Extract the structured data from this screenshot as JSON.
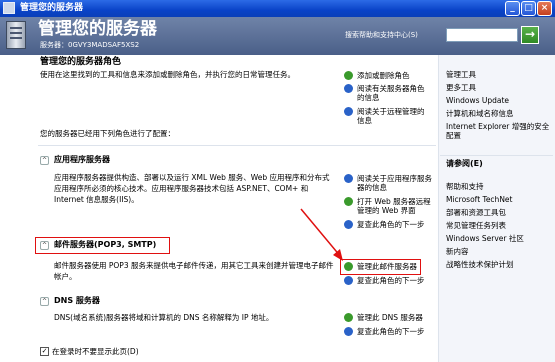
{
  "window": {
    "title": "管理您的服务器",
    "controls": {
      "minimize": "_",
      "maximize": "□",
      "close": "×"
    }
  },
  "header": {
    "title": "管理您的服务器",
    "server_label": "服务器：0GVY3MADSAF5XS2",
    "search_label": "搜索帮助和支持中心(S)",
    "search_value": "",
    "go_button": "→"
  },
  "main": {
    "heading": "管理您的服务器角色",
    "intro": "使用在这里找到的工具和信息来添加或删除角色，并执行您的日常管理任务。",
    "configured_text": "您的服务器已经用下列角色进行了配置：",
    "top_links": [
      {
        "label": "添加或删除角色",
        "icon": "go-arrow-icon"
      },
      {
        "label": "阅读有关服务器角色的信息",
        "icon": "info-icon"
      },
      {
        "label": "阅读关于远程管理的信息",
        "icon": "info-icon"
      }
    ],
    "roles": [
      {
        "title": "应用程序服务器",
        "desc": "应用程序服务器提供构造、部署以及运行 XML Web 服务、Web 应用程序和分布式应用程序所必须的核心技术。应用程序服务器技术包括 ASP.NET、COM+ 和 Internet 信息服务(IIS)。",
        "links": [
          {
            "label": "阅读关于应用程序服务器的信息",
            "icon": "info-icon"
          },
          {
            "label": "打开 Web 服务器远程管理的 Web 界面",
            "icon": "go-arrow-icon"
          },
          {
            "label": "复查此角色的下一步",
            "icon": "info-icon"
          }
        ]
      },
      {
        "title": "邮件服务器(POP3, SMTP)",
        "desc": "邮件服务器使用 POP3 服务来提供电子邮件传递，用其它工具来创建并管理电子邮件帐户。",
        "links": [
          {
            "label": "管理此邮件服务器",
            "icon": "go-arrow-icon"
          },
          {
            "label": "复查此角色的下一步",
            "icon": "info-icon"
          }
        ]
      },
      {
        "title": "DNS 服务器",
        "desc": "DNS(域名系统)服务器将域和计算机的 DNS 名称解释为 IP 地址。",
        "links": [
          {
            "label": "管理此 DNS 服务器",
            "icon": "go-arrow-icon"
          },
          {
            "label": "复查此角色的下一步",
            "icon": "info-icon"
          }
        ]
      }
    ],
    "footer_checkbox": "在登录时不要显示此页(D)"
  },
  "right": {
    "tools_links": [
      "管理工具",
      "更多工具",
      "Windows Update",
      "计算机和域名称信息",
      "Internet Explorer 增强的安全配置"
    ],
    "see_also_title": "请参阅(E)",
    "see_also_links": [
      "帮助和支持",
      "Microsoft TechNet",
      "部署和资源工具包",
      "常见管理任务列表",
      "Windows Server 社区",
      "新内容",
      "战略性技术保护计划"
    ]
  },
  "colors": {
    "title_bar": "#0a43c8",
    "header": "#5a6e96",
    "highlight": "#e01010"
  }
}
